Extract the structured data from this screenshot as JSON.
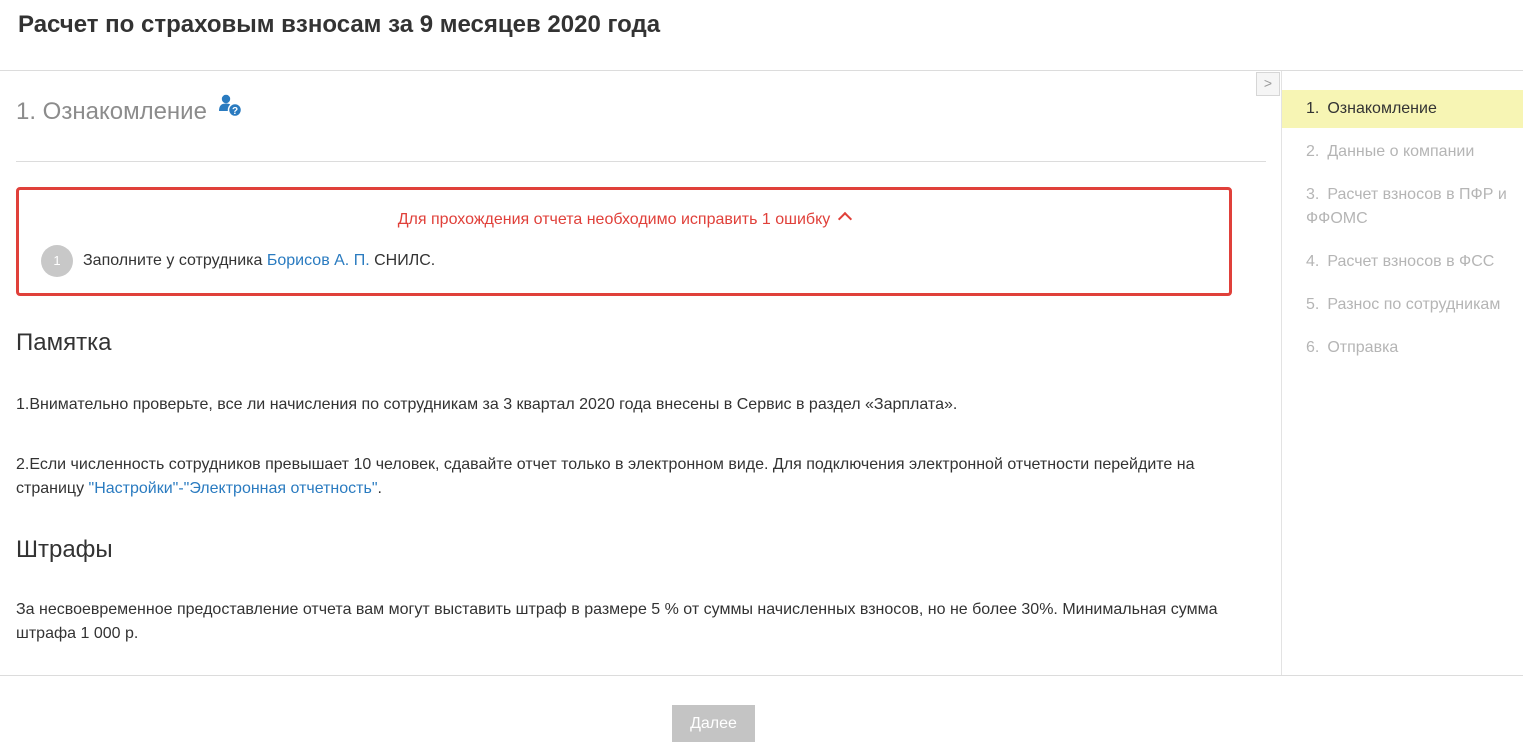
{
  "page": {
    "title": "Расчет по страховым взносам за 9 месяцев 2020 года"
  },
  "collapse_toggle": ">",
  "step": {
    "title": "1. Ознакомление"
  },
  "errors": {
    "summary": "Для прохождения отчета необходимо исправить 1 ошибку",
    "items": [
      {
        "number": "1",
        "prefix": "Заполните у сотрудника ",
        "link": "Борисов А. П.",
        "suffix": " СНИЛС."
      }
    ]
  },
  "memo": {
    "title": "Памятка",
    "p1": "1.Внимательно проверьте, все ли начисления по сотрудникам за 3 квартал 2020 года внесены в Сервис в раздел «Зарплата».",
    "p2_text": "2.Если численность сотрудников превышает 10 человек, сдавайте отчет только в электронном виде. Для подключения электронной отчетности перейдите на страницу ",
    "p2_link": "\"Настройки\"-\"Электронная отчетность\"",
    "p2_end": "."
  },
  "fines": {
    "title": "Штрафы",
    "text": "За несвоевременное предоставление отчета вам могут выставить штраф в размере 5 % от суммы начисленных взносов, но не более 30%. Минимальная сумма штрафа 1 000 р."
  },
  "sidebar": {
    "items": [
      {
        "num": "1.",
        "label": "Ознакомление",
        "active": true
      },
      {
        "num": "2.",
        "label": "Данные о компании",
        "active": false
      },
      {
        "num": "3.",
        "label": "Расчет взносов в ПФР и ФФОМС",
        "active": false
      },
      {
        "num": "4.",
        "label": "Расчет взносов в ФСС",
        "active": false
      },
      {
        "num": "5.",
        "label": "Разнос по сотрудникам",
        "active": false
      },
      {
        "num": "6.",
        "label": "Отправка",
        "active": false
      }
    ]
  },
  "footer": {
    "next_label": "Далее"
  },
  "colors": {
    "error": "#e0403a",
    "link": "#2a7bc0",
    "active_nav_bg": "#f7f5b4",
    "disabled_button": "#c4c4c4"
  },
  "icons": {
    "help": "user-help-icon",
    "chevron": "chevron-up-icon"
  }
}
